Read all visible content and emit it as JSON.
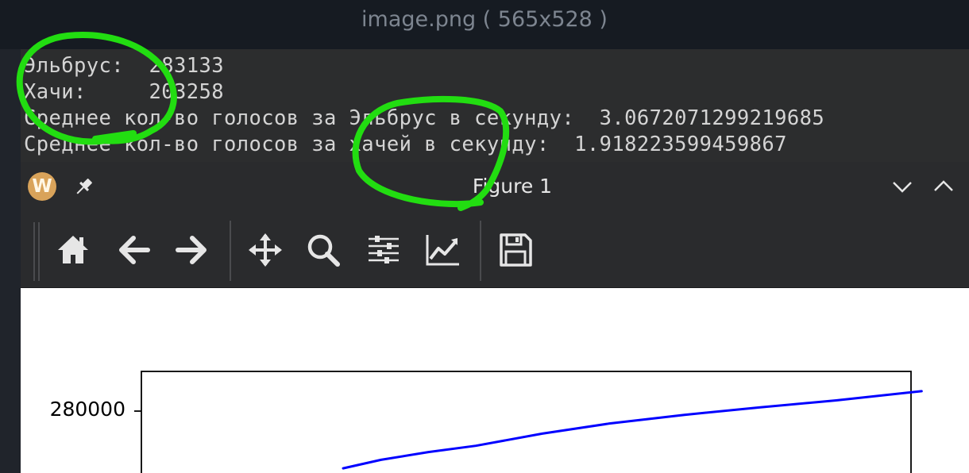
{
  "viewer": {
    "title": "image.png ( 565x528 )"
  },
  "terminal": {
    "lines": [
      "Эльбрус:  283133",
      "Хачи:     203258",
      "Среднее кол-во голосов за Эльбрус в секунду:  3.0672071299219685",
      "Среднее кол-во голосов за хачей в секунду:  1.918223599459867"
    ]
  },
  "window": {
    "title": "Figure 1",
    "app_icon_letter": "W",
    "icons": {
      "app": "app-logo-icon",
      "pin": "pin-icon",
      "minimize": "chevron-down-icon",
      "maximize": "chevron-up-icon"
    }
  },
  "toolbar": {
    "tools": [
      "home-icon",
      "back-arrow-icon",
      "forward-arrow-icon",
      "pan-move-icon",
      "zoom-magnifier-icon",
      "subplots-sliders-icon",
      "edit-axes-line-icon",
      "save-floppy-icon"
    ]
  },
  "annotation": {
    "color": "#22dd11"
  },
  "chart_data": {
    "type": "line",
    "y_tick_labels": [
      "280000"
    ],
    "series": [
      {
        "color": "#0000ff",
        "x": [
          0.34,
          0.38,
          0.43,
          0.48,
          0.55,
          0.62,
          0.7,
          0.78,
          0.86,
          0.95
        ],
        "y": [
          264500,
          266800,
          268900,
          270600,
          273900,
          276600,
          279000,
          281000,
          282900,
          285400
        ]
      }
    ],
    "visible_y_range": [
      256000,
      292000
    ],
    "visible_x_range": [
      0,
      1
    ],
    "grid": false,
    "legend": false
  }
}
